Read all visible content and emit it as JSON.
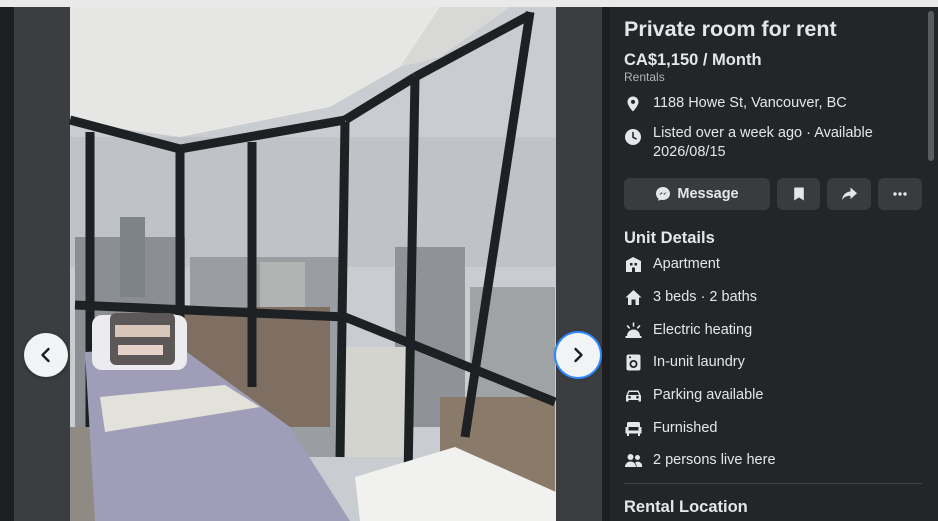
{
  "listing": {
    "title": "Private room for rent",
    "price": "CA$1,150 / Month",
    "category": "Rentals",
    "address": "1188 Howe St, Vancouver, BC",
    "listed": "Listed over a week ago · Available 2026/08/15"
  },
  "actions": {
    "message_label": "Message",
    "icons": [
      "messenger-icon",
      "bookmark-icon",
      "share-icon",
      "more-icon"
    ]
  },
  "unit_details": {
    "heading": "Unit Details",
    "items": [
      {
        "label": "Apartment",
        "icon": "building-icon"
      },
      {
        "label": "3 beds · 2 baths",
        "icon": "house-icon"
      },
      {
        "label": "Electric heating",
        "icon": "heater-icon"
      },
      {
        "label": "In-unit laundry",
        "icon": "washer-icon"
      },
      {
        "label": "Parking available",
        "icon": "car-icon"
      },
      {
        "label": "Furnished",
        "icon": "armchair-icon"
      },
      {
        "label": "2 persons live here",
        "icon": "people-icon"
      }
    ]
  },
  "rental_location": {
    "heading": "Rental Location"
  },
  "viewer": {
    "prev_icon": "chevron-left-icon",
    "next_icon": "chevron-right-icon"
  },
  "colors": {
    "panel_bg": "#242526",
    "button_bg": "#3a3b3c",
    "text": "#e4e6eb",
    "secondary_text": "#b0b3b8",
    "focus_ring": "#2d88ff"
  }
}
